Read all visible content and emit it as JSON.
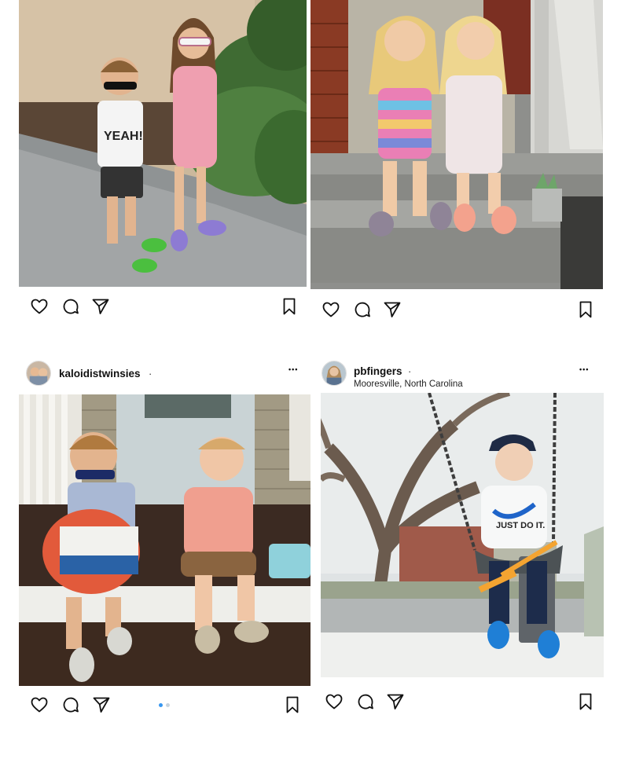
{
  "posts": [
    {
      "username": "",
      "location": "",
      "photo_alt": "",
      "shirt_text": "YEAH!",
      "carousel": false
    },
    {
      "username": "",
      "location": "",
      "carousel": false
    },
    {
      "username": "kaloidistwinsies",
      "separator": "·",
      "location": "",
      "more": "•••",
      "carousel": true,
      "carousel_count": 2,
      "carousel_active": 0
    },
    {
      "username": "pbfingers",
      "separator": "·",
      "location": "Mooresville, North Carolina",
      "more": "•••",
      "shirt_text": "JUST DO IT.",
      "carousel": false
    }
  ],
  "icons": {
    "like": "heart-icon",
    "comment": "comment-icon",
    "share": "paper-plane-icon",
    "save": "bookmark-icon",
    "more": "more-options-icon"
  },
  "colors": {
    "icon_stroke": "#111111",
    "carousel_active": "#3897f0",
    "carousel_inactive": "#c8d3dc"
  }
}
